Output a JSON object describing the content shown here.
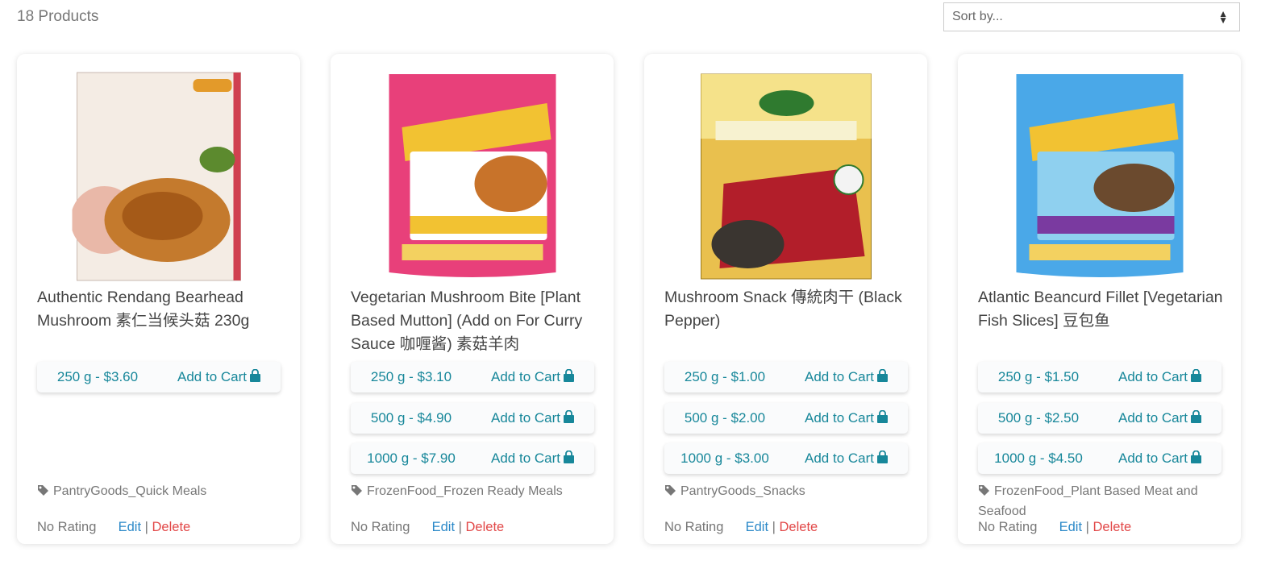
{
  "header": {
    "count": "18 Products",
    "sort_label": "Sort by..."
  },
  "products": [
    {
      "title": "Authentic Rendang Bearhead Mushroom 素仁当候头菇 230g",
      "image_theme": "rendang",
      "variants": [
        {
          "price": "250 g - $3.60",
          "add": "Add to Cart"
        }
      ],
      "category": "PantryGoods_Quick Meals",
      "rating": "No Rating",
      "edit": "Edit",
      "sep": "|",
      "delete": "Delete"
    },
    {
      "title": "Vegetarian Mushroom Bite [Plant Based Mutton] (Add on For Curry Sauce 咖喱酱) 素菇羊肉",
      "image_theme": "pink-pouch",
      "variants": [
        {
          "price": "250 g - $3.10",
          "add": "Add to Cart"
        },
        {
          "price": "500 g - $4.90",
          "add": "Add to Cart"
        },
        {
          "price": "1000 g - $7.90",
          "add": "Add to Cart"
        }
      ],
      "category": "FrozenFood_Frozen Ready Meals",
      "rating": "No Rating",
      "edit": "Edit",
      "sep": "|",
      "delete": "Delete"
    },
    {
      "title": "Mushroom Snack 傳統肉干 (Black Pepper)",
      "image_theme": "black-pepper-box",
      "variants": [
        {
          "price": "250 g - $1.00",
          "add": "Add to Cart"
        },
        {
          "price": "500 g - $2.00",
          "add": "Add to Cart"
        },
        {
          "price": "1000 g - $3.00",
          "add": "Add to Cart"
        }
      ],
      "category": "PantryGoods_Snacks",
      "rating": "No Rating",
      "edit": "Edit",
      "sep": "|",
      "delete": "Delete"
    },
    {
      "title": "Atlantic Beancurd Fillet [Vegetarian Fish Slices] 豆包鱼",
      "image_theme": "blue-pouch",
      "variants": [
        {
          "price": "250 g - $1.50",
          "add": "Add to Cart"
        },
        {
          "price": "500 g - $2.50",
          "add": "Add to Cart"
        },
        {
          "price": "1000 g - $4.50",
          "add": "Add to Cart"
        }
      ],
      "category": "FrozenFood_Plant Based Meat and Seafood",
      "rating": "No Rating",
      "edit": "Edit",
      "sep": "|",
      "delete": "Delete"
    }
  ],
  "icons": {
    "sort": "sort-caret-icon",
    "cart": "shopping-bag-icon",
    "tag": "tag-icon"
  },
  "colors": {
    "accent": "#17879a",
    "edit": "#2a88c8",
    "delete": "#e24848",
    "muted": "#777777"
  }
}
